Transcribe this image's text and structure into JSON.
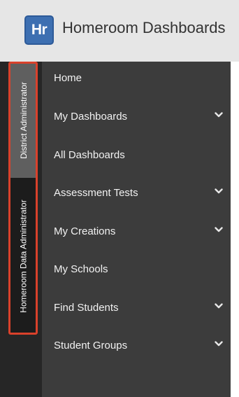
{
  "header": {
    "logo_text": "Hr",
    "title": "Homeroom Dashboards"
  },
  "roles": [
    {
      "label": "District Administrator",
      "selected": true
    },
    {
      "label": "Homeroom Data Administrator",
      "selected": false
    }
  ],
  "nav": {
    "items": [
      {
        "label": "Home",
        "has_submenu": false
      },
      {
        "label": "My Dashboards",
        "has_submenu": true,
        "icon": "chevron-down-icon"
      },
      {
        "label": "All Dashboards",
        "has_submenu": false
      },
      {
        "label": "Assessment Tests",
        "has_submenu": true,
        "icon": "chevron-down-icon"
      },
      {
        "label": "My Creations",
        "has_submenu": true,
        "icon": "chevron-down-icon"
      },
      {
        "label": "My Schools",
        "has_submenu": false
      },
      {
        "label": "Find Students",
        "has_submenu": true,
        "icon": "chevron-down-icon"
      },
      {
        "label": "Student Groups",
        "has_submenu": true,
        "icon": "chevron-down-icon"
      }
    ]
  },
  "colors": {
    "header_bg": "#e6e6e6",
    "logo_bg": "#3d6fb1",
    "sidebar_bg": "#3c3c3c",
    "rail_bg": "#262626",
    "highlight": "#d9412b"
  }
}
